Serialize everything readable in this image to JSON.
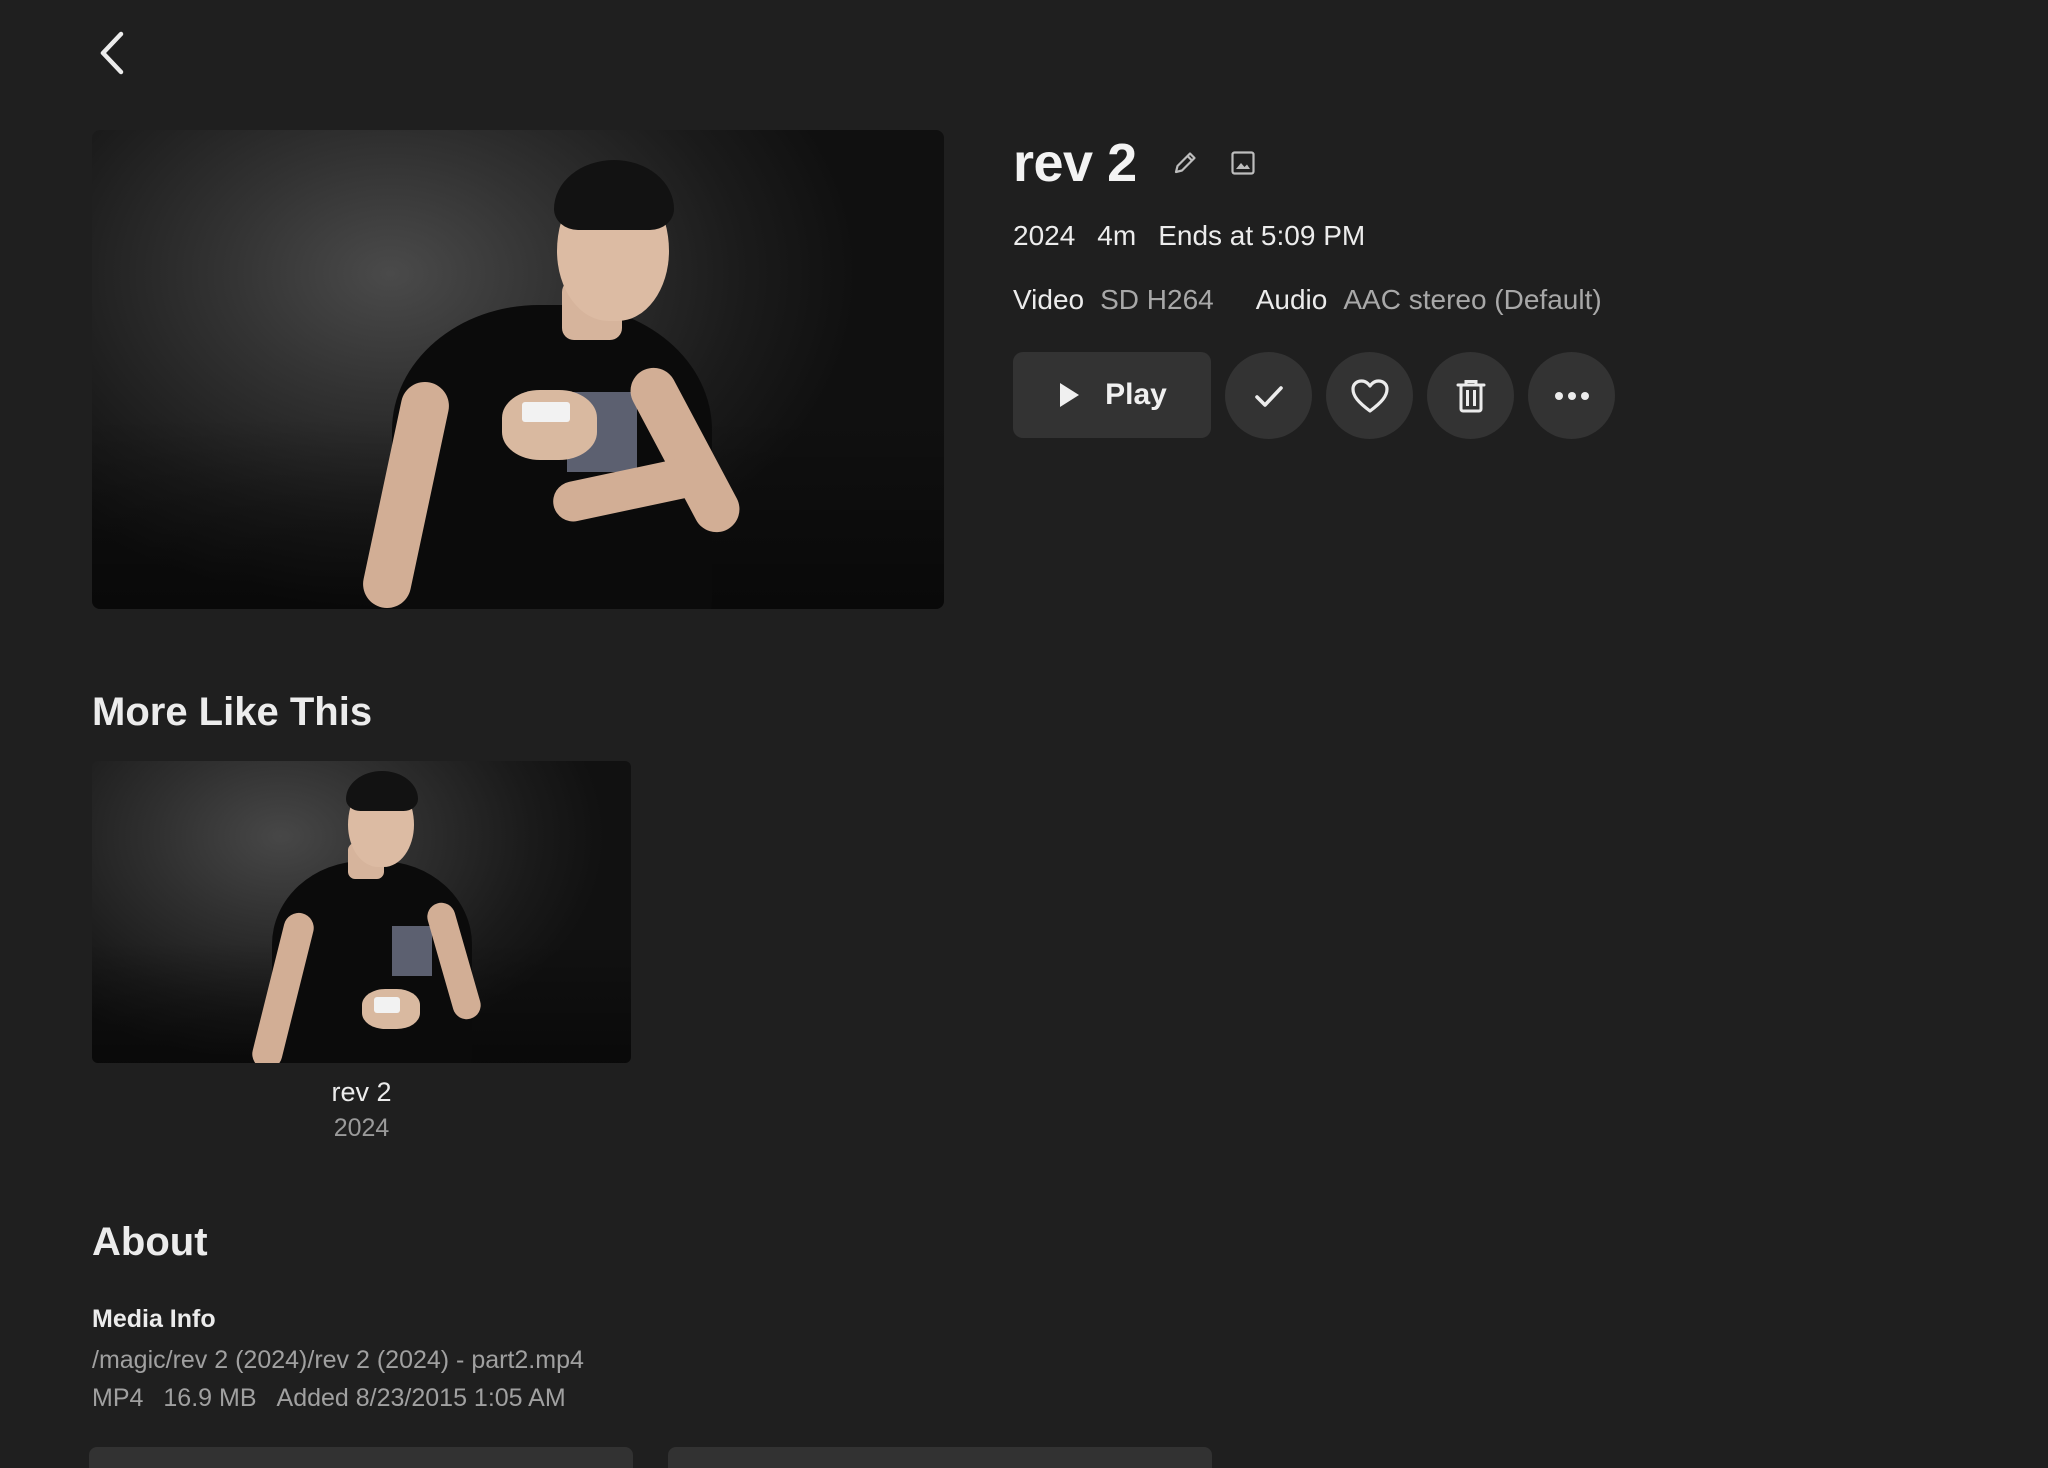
{
  "header": {
    "back_icon": "chevron-left-icon"
  },
  "item": {
    "title": "rev 2",
    "year": "2024",
    "runtime": "4m",
    "ends_at": "Ends at 5:09 PM",
    "video_label": "Video",
    "video_value": "SD H264",
    "audio_label": "Audio",
    "audio_value": "AAC stereo (Default)"
  },
  "actions": {
    "play_label": "Play",
    "icons": [
      "edit-pencil-icon",
      "image-icon",
      "play-icon",
      "check-icon",
      "heart-icon",
      "trash-icon",
      "more-horizontal-icon"
    ]
  },
  "more_like_this": {
    "heading": "More Like This",
    "items": [
      {
        "title": "rev 2",
        "year": "2024"
      }
    ]
  },
  "about": {
    "heading": "About",
    "media_info_label": "Media Info",
    "path": "/magic/rev 2 (2024)/rev 2 (2024) - part2.mp4",
    "container": "MP4",
    "size": "16.9 MB",
    "added": "Added 8/23/2015 1:05 AM"
  },
  "colors": {
    "background": "#1f1f1f",
    "button": "#333333",
    "text": "#ececec",
    "muted": "#a0a0a0"
  }
}
